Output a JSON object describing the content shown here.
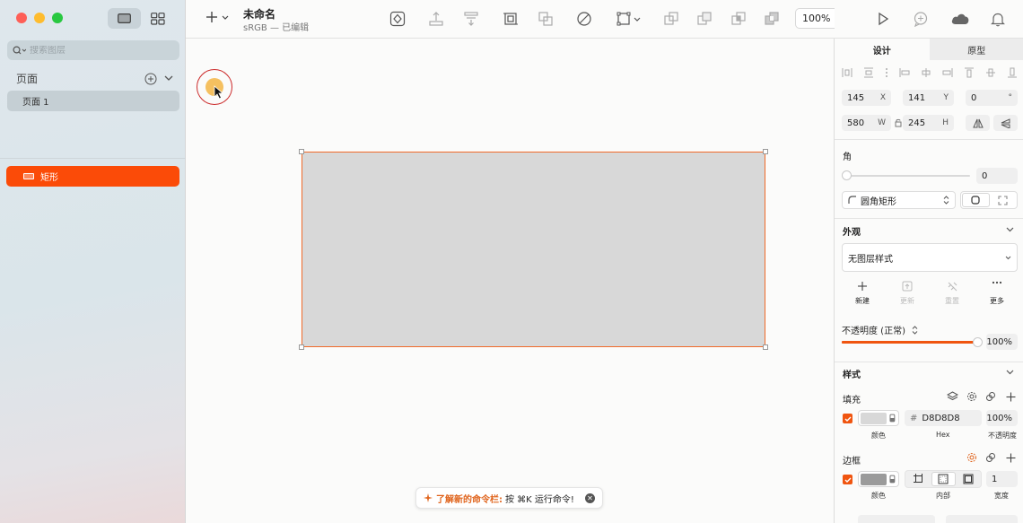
{
  "sidebar": {
    "search_placeholder": "搜索图层",
    "pages_label": "页面",
    "pages": [
      {
        "label": "页面 1"
      }
    ],
    "layers": [
      {
        "label": "矩形"
      }
    ]
  },
  "toolbar": {
    "doc_title": "未命名",
    "doc_subtitle": "sRGB — 已编辑",
    "zoom": "100%"
  },
  "canvas": {
    "command_hint_highlight": "了解新的命令栏:",
    "command_hint_text": "按 ⌘K 运行命令!"
  },
  "inspector": {
    "tabs": [
      "设计",
      "原型"
    ],
    "x": {
      "value": "145",
      "label": "X"
    },
    "y": {
      "value": "141",
      "label": "Y"
    },
    "rotation": {
      "value": "0",
      "label": "°"
    },
    "w": {
      "value": "580",
      "label": "W"
    },
    "h": {
      "value": "245",
      "label": "H"
    },
    "corner": {
      "title": "角",
      "value": "0",
      "type_label": "圆角矩形"
    },
    "appearance": {
      "title": "外观",
      "style_label": "无图层样式",
      "actions": [
        "新建",
        "更新",
        "重置",
        "更多"
      ],
      "opacity_label": "不透明度 (正常)",
      "opacity_value": "100%",
      "opacity_level": 1.0
    },
    "style": {
      "title": "样式"
    },
    "fill": {
      "title": "填充",
      "hex": "D8D8D8",
      "hex_prefix": "#",
      "opacity": "100%",
      "label_color": "颜色",
      "label_hex": "Hex",
      "label_opacity": "不透明度",
      "color": "#d8d8d8"
    },
    "border": {
      "title": "边框",
      "width": "1",
      "label_color": "颜色",
      "label_position": "内部",
      "label_width": "宽度",
      "color": "#9b9b9b"
    }
  },
  "colors": {
    "accent": "#fb4b08"
  }
}
